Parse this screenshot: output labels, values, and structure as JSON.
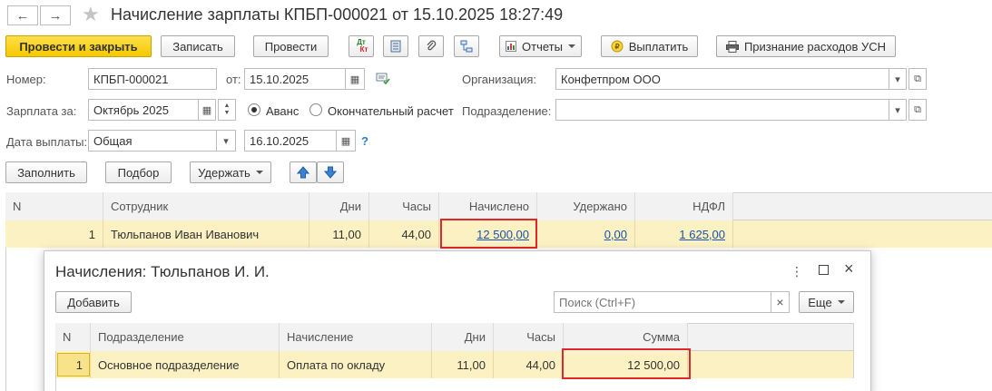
{
  "window": {
    "title": "Начисление зарплаты КПБП-000021 от 15.10.2025 18:27:49",
    "back_icon": "arrow-left-icon",
    "forward_icon": "arrow-right-icon",
    "favorite_icon": "star-icon"
  },
  "toolbar": {
    "post_close": "Провести и закрыть",
    "write": "Записать",
    "post": "Провести",
    "dtkt_dt": "Дт",
    "dtkt_kt": "Кт",
    "reports": "Отчеты",
    "pay": "Выплатить",
    "usn": "Признание расходов УСН"
  },
  "form": {
    "number_label": "Номер:",
    "number_value": "КПБП-000021",
    "from_label": "от:",
    "from_value": "15.10.2025",
    "org_label": "Организация:",
    "org_value": "Конфетпром ООО",
    "salary_for_label": "Зарплата за:",
    "salary_for_value": "Октябрь 2025",
    "radio_advance": "Аванс",
    "radio_final": "Окончательный расчет",
    "division_label": "Подразделение:",
    "division_value": "",
    "pay_date_label": "Дата выплаты:",
    "pay_type_value": "Общая",
    "pay_date_value": "16.10.2025",
    "help": "?"
  },
  "actions": {
    "fill": "Заполнить",
    "select": "Подбор",
    "withhold": "Удержать"
  },
  "table": {
    "headers": {
      "n": "N",
      "employee": "Сотрудник",
      "days": "Дни",
      "hours": "Часы",
      "accrued": "Начислено",
      "withheld": "Удержано",
      "ndfl": "НДФЛ"
    },
    "rows": [
      {
        "n": "1",
        "employee": "Тюльпанов Иван Иванович",
        "days": "11,00",
        "hours": "44,00",
        "accrued": "12 500,00",
        "withheld": "0,00",
        "ndfl": "1 625,00"
      }
    ]
  },
  "popup": {
    "title": "Начисления: Тюльпанов И. И.",
    "add": "Добавить",
    "search_placeholder": "Поиск (Ctrl+F)",
    "clear": "×",
    "more": "Еще",
    "headers": {
      "n": "N",
      "division": "Подразделение",
      "accrual": "Начисление",
      "days": "Дни",
      "hours": "Часы",
      "sum": "Сумма"
    },
    "rows": [
      {
        "n": "1",
        "division": "Основное подразделение",
        "accrual": "Оплата по окладу",
        "days": "11,00",
        "hours": "44,00",
        "sum": "12 500,00"
      }
    ]
  },
  "colors": {
    "primary_button": "#f5c800",
    "selected_row": "#fbf1c2",
    "highlight": "#e0282a",
    "link": "#1a52a9"
  }
}
